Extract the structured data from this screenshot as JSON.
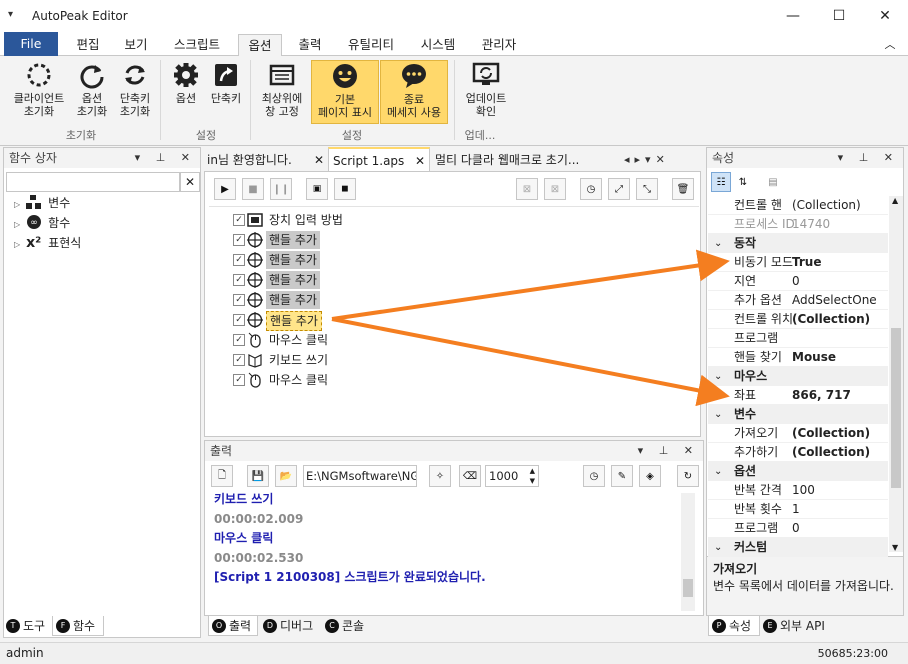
{
  "window": {
    "title": "AutoPeak Editor",
    "app_menu": "▾",
    "minimize": "—",
    "maximize": "☐",
    "close": "✕"
  },
  "ribbon_tabs": [
    "File",
    "편집",
    "보기",
    "스크립트",
    "옵션",
    "출력",
    "유틸리티",
    "시스템",
    "관리자"
  ],
  "ribbon_collapse": "︿",
  "ribbon": {
    "buttons": [
      {
        "label1": "클라이언트",
        "label2": "초기화"
      },
      {
        "label1": "옵션",
        "label2": "초기화"
      },
      {
        "label1": "단축키",
        "label2": "초기화"
      },
      {
        "label1": "옵션",
        "label2": ""
      },
      {
        "label1": "단축키",
        "label2": ""
      },
      {
        "label1": "최상위에",
        "label2": "창 고정"
      },
      {
        "label1": "기본",
        "label2": "페이지 표시"
      },
      {
        "label1": "종료",
        "label2": "메세지 사용"
      },
      {
        "label1": "업데이트",
        "label2": "확인"
      }
    ],
    "groups": [
      "초기화",
      "설정",
      "설정",
      "업데..."
    ]
  },
  "functions_panel": {
    "title": "함수 상자",
    "search_clear": "✕",
    "tree": [
      {
        "label": "변수",
        "icon": "variable-icon"
      },
      {
        "label": "함수",
        "icon": "infinity-icon"
      },
      {
        "label": "표현식",
        "icon": "x-squared-icon"
      }
    ],
    "bottom_tabs": [
      {
        "circle": "T",
        "label": "도구"
      },
      {
        "circle": "F",
        "label": "함수"
      }
    ]
  },
  "doc_tabs": [
    {
      "label": "in님 환영합니다."
    },
    {
      "label": "Script 1.aps"
    },
    {
      "label": "멀티 다클라 웹매크로 초기..."
    }
  ],
  "script_items": [
    {
      "label": "장치 입력 방법",
      "style": "normal",
      "icon": "device-icon"
    },
    {
      "label": "핸들 추가",
      "style": "gray",
      "icon": "crosshair-icon"
    },
    {
      "label": "핸들 추가",
      "style": "gray",
      "icon": "crosshair-icon"
    },
    {
      "label": "핸들 추가",
      "style": "gray",
      "icon": "crosshair-icon"
    },
    {
      "label": "핸들 추가",
      "style": "gray",
      "icon": "crosshair-icon"
    },
    {
      "label": "핸들 추가",
      "style": "sel",
      "icon": "crosshair-icon"
    },
    {
      "label": "마우스 클릭",
      "style": "normal",
      "icon": "mouse-icon"
    },
    {
      "label": "키보드 쓰기",
      "style": "normal",
      "icon": "keyboard-icon"
    },
    {
      "label": "마우스 클릭",
      "style": "normal",
      "icon": "mouse-icon"
    }
  ],
  "output_panel": {
    "title": "출력",
    "path": "E:\\NGMsoftware\\NG",
    "count": "1000",
    "lines": [
      {
        "text": "키보드 쓰기",
        "color": "#1f1fb0",
        "bold": true
      },
      {
        "text": "00:00:02.009",
        "color": "#8a8a8a",
        "bold": true
      },
      {
        "text": "마우스 클릭",
        "color": "#1f1fb0",
        "bold": true
      },
      {
        "text": "00:00:02.530",
        "color": "#8a8a8a",
        "bold": true
      },
      {
        "text": "[Script 1 2100308] 스크립트가 완료되었습니다.",
        "color": "#1f1fb0",
        "bold": true
      }
    ],
    "bottom_tabs": [
      {
        "circle": "O",
        "label": "출력"
      },
      {
        "circle": "D",
        "label": "디버그"
      },
      {
        "circle": "C",
        "label": "콘솔"
      }
    ]
  },
  "properties_panel": {
    "title": "속성",
    "rows": [
      {
        "type": "row",
        "key": "컨트롤 핸",
        "value": "(Collection)",
        "bold": false,
        "dim": false
      },
      {
        "type": "row",
        "key": "프로세스 ID",
        "value": "14740",
        "bold": false,
        "dim": true
      },
      {
        "type": "cat",
        "key": "동작"
      },
      {
        "type": "row",
        "key": "비동기 모드",
        "value": "True",
        "bold": true,
        "dim": false
      },
      {
        "type": "row",
        "key": "지연",
        "value": "0",
        "bold": false,
        "dim": false
      },
      {
        "type": "row",
        "key": "추가 옵션",
        "value": "AddSelectOne",
        "bold": false,
        "dim": false
      },
      {
        "type": "row",
        "key": "컨트롤 위치",
        "value": "(Collection)",
        "bold": true,
        "dim": false
      },
      {
        "type": "row",
        "key": "프로그램",
        "value": "",
        "bold": false,
        "dim": false
      },
      {
        "type": "row",
        "key": "핸들 찾기",
        "value": "Mouse",
        "bold": true,
        "dim": false
      },
      {
        "type": "cat",
        "key": "마우스"
      },
      {
        "type": "row",
        "key": "좌표",
        "value": "866, 717",
        "bold": true,
        "dim": false
      },
      {
        "type": "cat",
        "key": "변수"
      },
      {
        "type": "row",
        "key": "가져오기",
        "value": "(Collection)",
        "bold": true,
        "dim": false
      },
      {
        "type": "row",
        "key": "추가하기",
        "value": "(Collection)",
        "bold": true,
        "dim": false
      },
      {
        "type": "cat",
        "key": "옵션"
      },
      {
        "type": "row",
        "key": "반복 간격",
        "value": "100",
        "bold": false,
        "dim": false
      },
      {
        "type": "row",
        "key": "반복 횟수",
        "value": "1",
        "bold": false,
        "dim": false
      },
      {
        "type": "row",
        "key": "프로그램",
        "value": "0",
        "bold": false,
        "dim": false
      },
      {
        "type": "cat",
        "key": "커스텀"
      }
    ],
    "desc_title": "가져오기",
    "desc_text": "변수 목록에서 데이터를 가져옵니다.",
    "bottom_tabs": [
      {
        "circle": "P",
        "label": "속성"
      },
      {
        "circle": "E",
        "label": "외부 API"
      }
    ]
  },
  "status": {
    "left": "admin",
    "right": "50685:23:00"
  },
  "colors": {
    "accent": "#2b579a",
    "highlight": "#ffd86b",
    "arrow": "#f47e20"
  }
}
